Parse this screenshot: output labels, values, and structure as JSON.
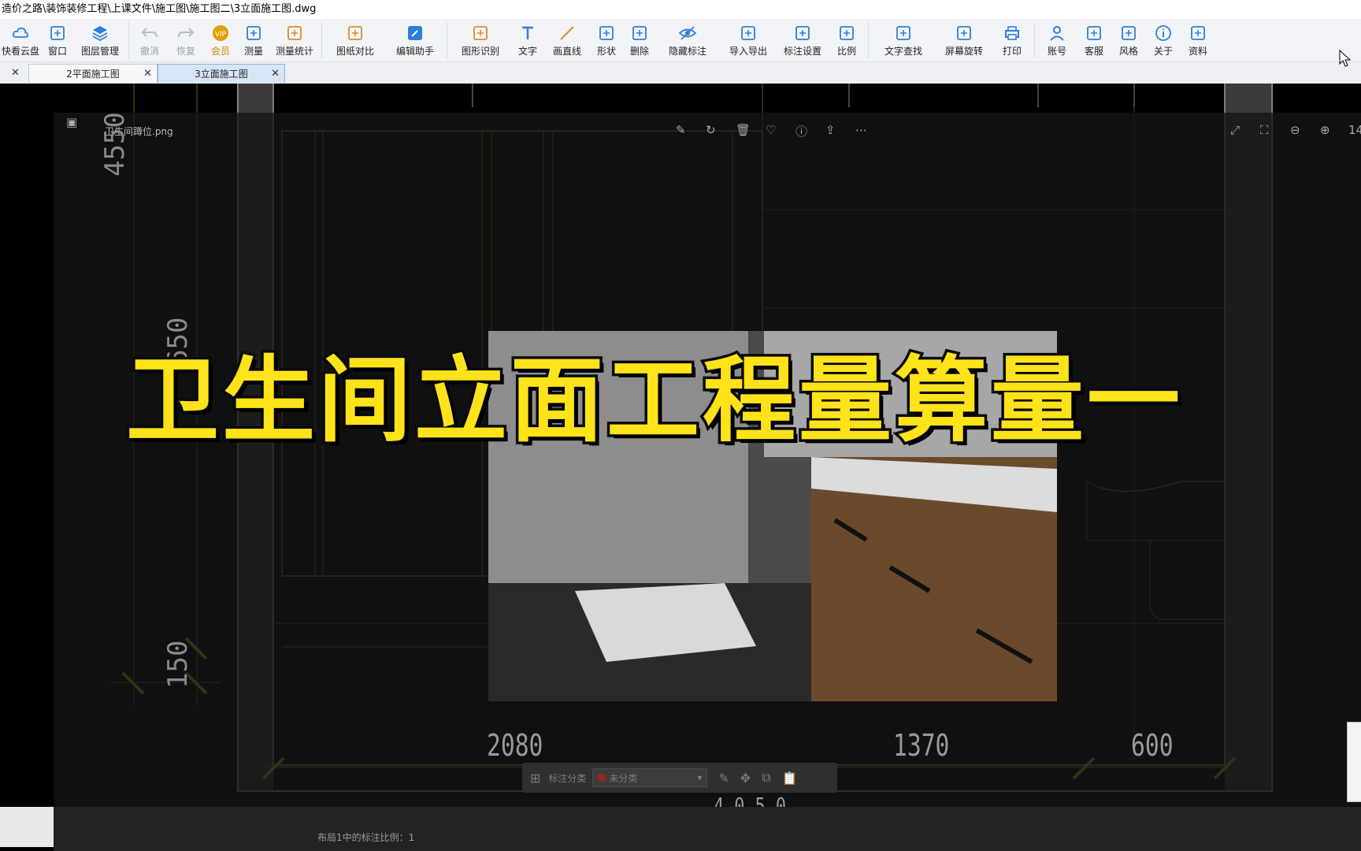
{
  "window": {
    "title": "造价之路\\装饰装修工程\\上课文件\\施工图\\施工图二\\3立面施工图.dwg"
  },
  "toolbar": {
    "items": [
      {
        "label": "快看云盘",
        "icon": "cloud-icon"
      },
      {
        "label": "窗口",
        "icon": "window-icon"
      },
      {
        "label": "图层管理",
        "icon": "layers-icon"
      },
      {
        "label": "撤消",
        "icon": "undo-icon",
        "disabled": true
      },
      {
        "label": "恢复",
        "icon": "redo-icon",
        "disabled": true
      },
      {
        "label": "会员",
        "icon": "vip-icon"
      },
      {
        "label": "测量",
        "icon": "ruler-icon"
      },
      {
        "label": "测量统计",
        "icon": "measure-stats-icon"
      },
      {
        "label": "图纸对比",
        "icon": "compare-icon"
      },
      {
        "label": "编辑助手",
        "icon": "edit-assistant-icon"
      },
      {
        "label": "图形识别",
        "icon": "shape-recognize-icon"
      },
      {
        "label": "文字",
        "icon": "text-icon"
      },
      {
        "label": "画直线",
        "icon": "line-icon"
      },
      {
        "label": "形状",
        "icon": "shape-icon"
      },
      {
        "label": "删除",
        "icon": "eraser-icon"
      },
      {
        "label": "隐藏标注",
        "icon": "eye-hide-icon"
      },
      {
        "label": "导入导出",
        "icon": "import-export-icon"
      },
      {
        "label": "标注设置",
        "icon": "annotation-settings-icon"
      },
      {
        "label": "比例",
        "icon": "scale-icon"
      },
      {
        "label": "文字查找",
        "icon": "text-search-icon"
      },
      {
        "label": "屏幕旋转",
        "icon": "screen-rotate-icon"
      },
      {
        "label": "打印",
        "icon": "print-icon"
      },
      {
        "label": "账号",
        "icon": "account-icon"
      },
      {
        "label": "客服",
        "icon": "headset-icon"
      },
      {
        "label": "风格",
        "icon": "style-icon"
      },
      {
        "label": "关于",
        "icon": "info-icon"
      },
      {
        "label": "资料",
        "icon": "docs-icon"
      }
    ]
  },
  "tabs": [
    {
      "label": "2平面施工图",
      "active": false
    },
    {
      "label": "3立面施工图",
      "active": true
    }
  ],
  "viewer": {
    "filename": "卫生间蹲位.png",
    "zoom_partial": "14"
  },
  "overlay": {
    "headline": "卫生间立面工程量算量一"
  },
  "drawing": {
    "dims_bottom": [
      "2080",
      "1370",
      "600"
    ],
    "dims_left": [
      "4550",
      "650",
      "150"
    ],
    "dim_partial": "4 0 5 0"
  },
  "annotation_bar": {
    "label": "标注分类",
    "selected": "未分类"
  },
  "status": {
    "text": "布局1中的标注比例：1"
  },
  "colors": {
    "accent_yellow": "#ffe31a",
    "toolbar_bg": "#f2f4f7",
    "active_tab": "#d6e6f7"
  }
}
